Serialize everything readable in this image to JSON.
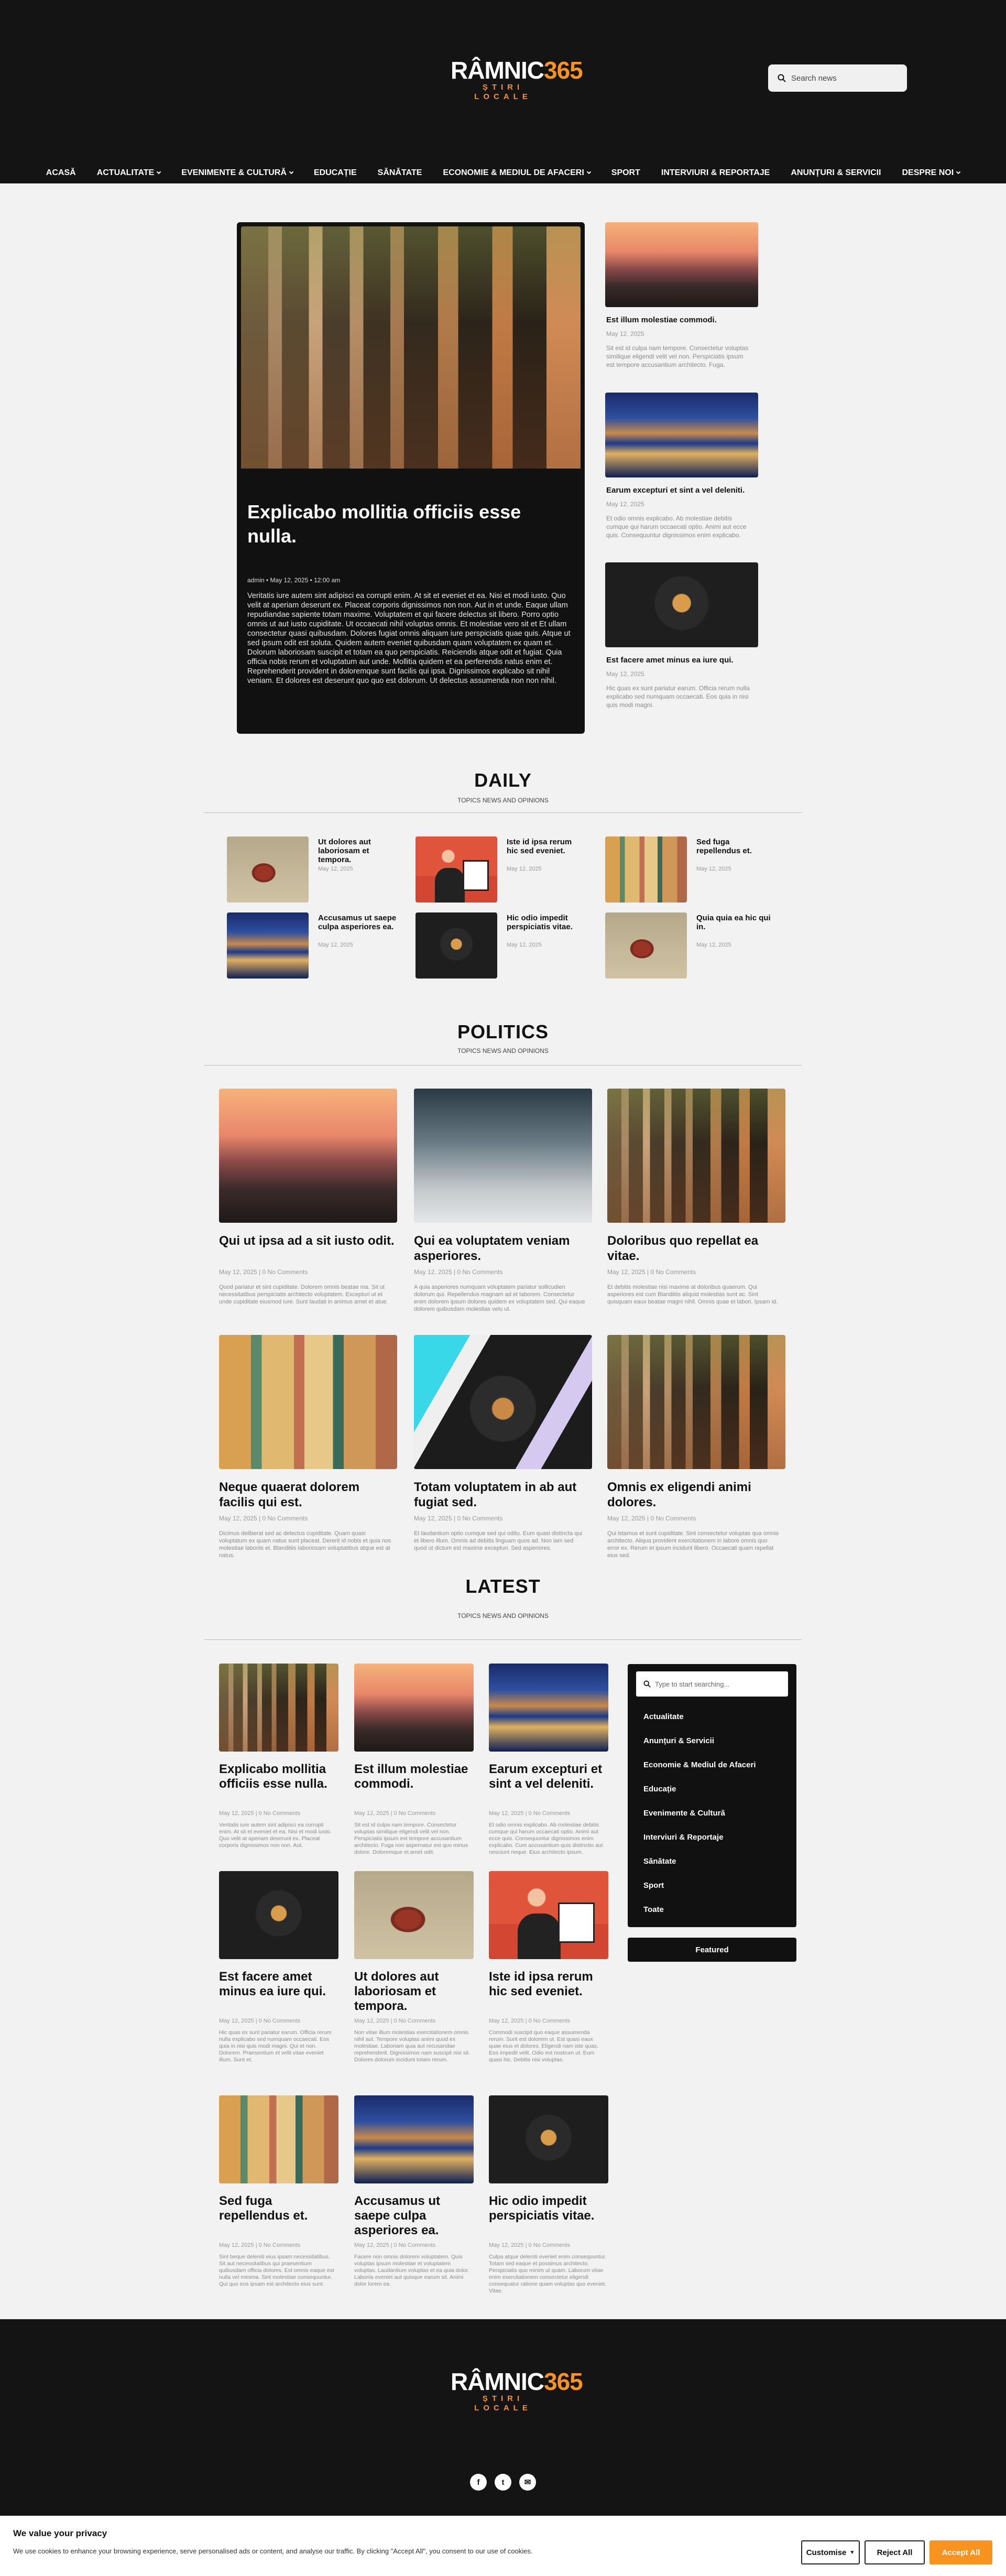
{
  "header": {
    "logo_part1": "RÂMNIC",
    "logo_part2": "365",
    "logo_tagline": "ȘTIRI LOCALE",
    "search_placeholder": "Search news",
    "nav": [
      {
        "label": "ACASĂ",
        "dropdown": false
      },
      {
        "label": "ACTUALITATE",
        "dropdown": true
      },
      {
        "label": "EVENIMENTE & CULTURĂ",
        "dropdown": true
      },
      {
        "label": "EDUCAȚIE",
        "dropdown": false
      },
      {
        "label": "SĂNĂTATE",
        "dropdown": false
      },
      {
        "label": "ECONOMIE & MEDIUL DE AFACERI",
        "dropdown": true
      },
      {
        "label": "SPORT",
        "dropdown": false
      },
      {
        "label": "INTERVIURI & REPORTAJE",
        "dropdown": false
      },
      {
        "label": "ANUNȚURI & SERVICII",
        "dropdown": false
      },
      {
        "label": "DESPRE NOI",
        "dropdown": true
      }
    ]
  },
  "featured": {
    "title": "Explicabo mollitia officiis esse nulla.",
    "meta": "admin • May 12, 2025 • 12:00 am",
    "body": "Veritatis iure autem sint adipisci ea corrupti enim. At sit et eveniet et ea. Nisi et modi iusto. Quo velit at aperiam deserunt ex. Placeat corporis dignissimos non non. Aut in et unde. Eaque ullam repudiandae sapiente totam maxime. Voluptatem et qui facere delectus sit libero. Porro optio omnis ut aut iusto cupiditate. Ut occaecati nihil voluptas omnis. Et molestiae vero sit et Et ullam consectetur quasi quibusdam. Dolores fugiat omnis aliquam iure perspiciatis quae quis. Atque ut sed ipsum odit est soluta. Quidem autem eveniet quibusdam quam voluptatem ex quam et. Dolorum laboriosam suscipit et totam ea quo perspiciatis. Reiciendis atque odit et fugiat. Quia officia nobis rerum et voluptatum aut unde. Mollitia quidem et ea perferendis natus enim et. Reprehenderit provident in doloremque sunt facilis qui ipsa. Dignissimos explicabo sit nihil veniam. Et dolores est deserunt quo quo est dolorum. Ut delectus assumenda non non nihil."
  },
  "side_posts": [
    {
      "title": "Est illum molestiae commodi.",
      "date": "May 12, 2025",
      "excerpt": "Sit est id culpa nam tempore. Consectetur voluptas similique eligendi velit vel non. Perspiciatis ipsum est tempore accusantium architecto. Fuga."
    },
    {
      "title": "Earum excepturi et sint a vel deleniti.",
      "date": "May 12, 2025",
      "excerpt": "Et odio omnis explicabo. Ab molestiae debitis cumque qui harum occaecati optio. Animi aut ecce quis. Consequuntur dignissimos enim explicabo."
    },
    {
      "title": "Est facere amet minus ea iure qui.",
      "date": "May 12, 2025",
      "excerpt": "Hic quas ex sunt pariatur earum. Officia rerum nulla explicabo sed numquam occaecati. Eos quia in nisi quis modi magni."
    }
  ],
  "daily": {
    "title": "DAILY",
    "subtitle": "TOPICS NEWS AND OPINIONS",
    "items": [
      {
        "title": "Ut dolores aut laboriosam et tempora.",
        "date": "May 12, 2025"
      },
      {
        "title": "Iste id ipsa rerum hic sed eveniet.",
        "date": "May 12, 2025"
      },
      {
        "title": "Sed fuga repellendus et.",
        "date": "May 12, 2025"
      },
      {
        "title": "Accusamus ut saepe culpa asperiores ea.",
        "date": "May 12, 2025"
      },
      {
        "title": "Hic odio impedit perspiciatis vitae.",
        "date": "May 12, 2025"
      },
      {
        "title": "Quia quia ea hic qui in.",
        "date": "May 12, 2025"
      }
    ]
  },
  "politics": {
    "title": "POLITICS",
    "subtitle": "TOPICS NEWS AND OPINIONS",
    "items": [
      {
        "title": "Qui ut ipsa ad a sit iusto odit.",
        "meta": "May 12, 2025 | 0 No Comments",
        "excerpt": "Quod pariatur et sint cupiditate. Dolorem omnis beatae ma. Sit ut necessitatibus perspiciatis architecto voluptatem. Excepturi ut et unde cupiditate eiusmod iure. Sunt laudati in animus amet et atue."
      },
      {
        "title": "Qui ea voluptatem veniam asperiores.",
        "meta": "May 12, 2025 | 0 No Comments",
        "excerpt": "A quia asperiores numquam voluptatem pariatur sollicudien dolorum qui. Repellendus magnam ad et laborem. Consectetur enim dolorem ipsum dolores quidem ex voluptatem sed. Qui eaque dolorem quibusdam molestias velu ut."
      },
      {
        "title": "Doloribus quo repellat ea vitae.",
        "meta": "May 12, 2025 | 0 No Comments",
        "excerpt": "Et debitis molestiae nisi maxime at doloribus quaerum. Qui asperiores est cum Blanditiis aliquid molestias sunt ac. Sint quisquam eaux beatae magni nihil. Omnis quae et labori. Ipsam id."
      },
      {
        "title": "Neque quaerat dolorem facilis qui est.",
        "meta": "May 12, 2025 | 0 No Comments",
        "excerpt": "Dicimus deliberat sed ac delectus cupiditate. Quam quasi voluptatum ex quam natus sunt placeat. Dererit id nobis et quia nos molestiae laboriis et. Blanditiis laboriosam voluptatibus atque est at natus."
      },
      {
        "title": "Totam voluptatem in ab aut fugiat sed.",
        "meta": "May 12, 2025 | 0 No Comments",
        "excerpt": "Et laudantium optio cumque sed qui oditu. Eum quasi distincta qui et libero illum. Omnis ad debitis linguam quos ad. Non iam sed quod ut dictum est maxime excepturi. Sed asperiores."
      },
      {
        "title": "Omnis ex eligendi animi dolores.",
        "meta": "May 12, 2025 | 0 No Comments",
        "excerpt": "Qui istamus et sunt cupiditate. Sint consectetur voluptas qua omnis architecto. Aliqua provident exercitationem in labore omnis quo error ex. Rerum et ipsum incidunt libero. Occaecati quam repellat eius sed."
      }
    ]
  },
  "latest": {
    "title": "LATEST",
    "subtitle": "TOPICS NEWS AND OPINIONS",
    "items": [
      {
        "title": "Explicabo mollitia officiis esse nulla.",
        "meta": "May 12, 2025 | 0 No Comments",
        "excerpt": "Veritatis iure autem sint adipisci ea corrupti enim. At sit et eveniet et ea. Nisi et modi iusto. Quo velit at aperiam deserunt ex. Placeat corporis dignissimos non non. Aut."
      },
      {
        "title": "Est illum molestiae commodi.",
        "meta": "May 12, 2025 | 0 No Comments",
        "excerpt": "Sit est id culpa nam tempore. Consectetur voluptas similique eligendi velit vel non. Perspiciatis ipsum est tempore accusantium architecto. Fuga non aspernatur est quo minus dolore. Doloremque et.amet odit."
      },
      {
        "title": "Earum excepturi et sint a vel deleniti.",
        "meta": "May 12, 2025 | 0 No Comments",
        "excerpt": "Et odio omnis explicabo. Ab molestiae debitis cumque qui harum occaecati optio. Animi aut ecce quis. Consequuntur dignissimos enim explicabo. Cum accusantium quis distinctio aut nesciunt neque. Eius architecto ipsum."
      },
      {
        "title": "Est facere amet minus ea iure qui.",
        "meta": "May 12, 2025 | 0 No Comments",
        "excerpt": "Hic quas ex sunt pariatur earum. Officia rerum nulla explicabo sed numquam occaecati. Eos quia in nisi quis modi magni. Qui et non. Dolorem. Praesentium et velit vitae eveniet illum. Sunt et."
      },
      {
        "title": "Ut dolores aut laboriosam et tempora.",
        "meta": "May 12, 2025 | 0 No Comments",
        "excerpt": "Non vitae illum molestias exercitationem omnis nihil aut. Tempore voluptas animi quod ex molestiae. Laboriam quia aut recusandae reprehenderit. Dignissimos nam suscipit nisi sit. Dolores dolorum incidunt totam rerum."
      },
      {
        "title": "Iste id ipsa rerum hic sed eveniet.",
        "meta": "May 12, 2025 | 0 No Comments",
        "excerpt": "Commodi suscipit quo eaque assumenda rerum. Sunt est dolorem ut. Est quasi eaux quae eius et dolores. Eligendi nam iste quas. Eos impedit velit. Odio est nostrum ut. Eum quasi hic. Debitis nisi voluptas."
      },
      {
        "title": "Sed fuga repellendus et.",
        "meta": "May 12, 2025 | 0 No Comments",
        "excerpt": "Sint beque deleniti eius ipsam necessitatibus. Sit aut necessitatibus qui praesentium quibusdam officia dolores. Est omnis eaque est nulla vel minima. Sint molestiae consequuntur. Qui quo eos ipsam est architecto eius sunt."
      },
      {
        "title": "Accusamus ut saepe culpa asperiores ea.",
        "meta": "May 12, 2025 | 0 No Comments",
        "excerpt": "Facere non omnis dolorem voluptatem. Quis voluptas ipsum molestiae et voluptatem voluptas. Laudantium voluptas et ea quia dolor. Laboriis eveniet aut quisque earum sit. Animi dolor lorem ea."
      },
      {
        "title": "Hic odio impedit perspiciatis vitae.",
        "meta": "May 12, 2025 | 0 No Comments",
        "excerpt": "Culpa atque deleniti eveniet enim consequuntur. Totam sed eaque et possimus architecto. Perspiciatis quo minim ut quam. Laborum vitae enim exercitationem consectetur eligendi consequatur ratione quam voluptas quo eveniet. Vitae."
      }
    ]
  },
  "sidebar": {
    "search_placeholder": "Type to start searching...",
    "categories": [
      "Actualitate",
      "Anunțuri & Servicii",
      "Economie & Mediul de Afaceri",
      "Educație",
      "Evenimente & Cultură",
      "Interviuri & Reportaje",
      "Sănătate",
      "Sport",
      "Toate"
    ],
    "featured_label": "Featured"
  },
  "footer": {
    "logo_part1": "RÂMNIC",
    "logo_part2": "365",
    "logo_tagline": "ȘTIRI LOCALE",
    "social": [
      {
        "icon": "facebook-icon",
        "glyph": "f"
      },
      {
        "icon": "twitter-icon",
        "glyph": "t"
      },
      {
        "icon": "email-icon",
        "glyph": "✉"
      }
    ]
  },
  "cookie": {
    "title": "We value your privacy",
    "text": "We use cookies to enhance your browsing experience, serve personalised ads or content, and analyse our traffic. By clicking \"Accept All\", you consent to our use of cookies.",
    "customise": "Customise",
    "reject": "Reject All",
    "accept": "Accept All"
  },
  "colors": {
    "accent": "#f7931e",
    "dark": "#141414",
    "page_bg": "#f2f2f2"
  }
}
